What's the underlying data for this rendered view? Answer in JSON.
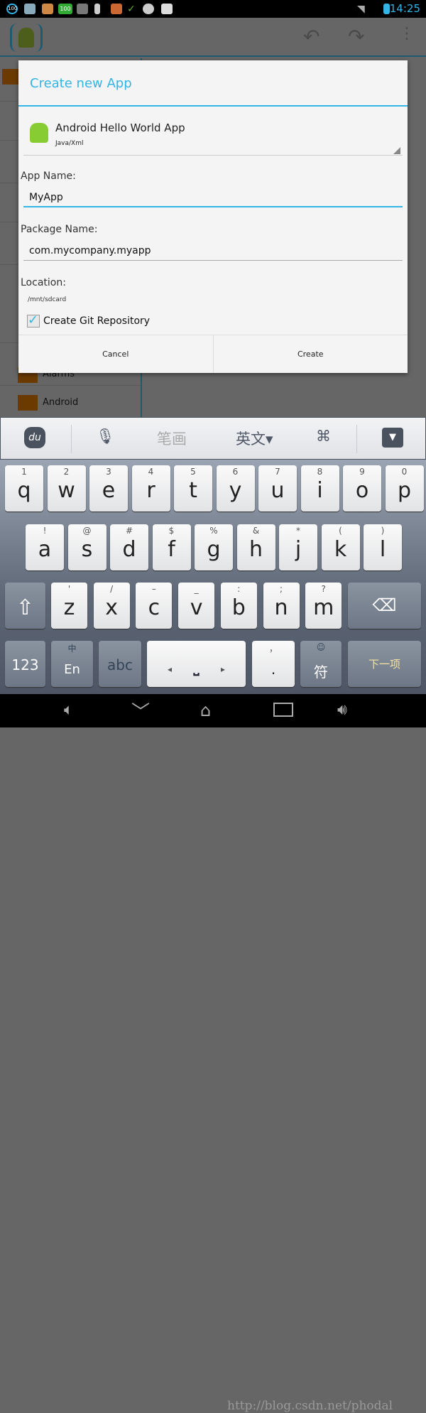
{
  "status": {
    "time": "14:25",
    "battery_label": "100",
    "notif_badge": "100"
  },
  "actionbar": {
    "icons": [
      "app-logo-icon",
      "undo-icon",
      "redo-icon",
      "overflow-icon"
    ]
  },
  "background_list": [
    "Alarms",
    "Android"
  ],
  "dialog": {
    "title": "Create new App",
    "template": {
      "name": "Android Hello World App",
      "subtitle": "Java/Xml"
    },
    "app_name_label": "App Name:",
    "app_name_value": "MyApp",
    "package_label": "Package Name:",
    "package_value": "com.mycompany.myapp",
    "location_label": "Location:",
    "location_value": "/mnt/sdcard",
    "git_label": "Create Git Repository",
    "git_checked": true,
    "cancel": "Cancel",
    "create": "Create"
  },
  "ime_bar": {
    "logo": "du",
    "stroke": "笔画",
    "lang": "英文▾"
  },
  "keyboard": {
    "row1": [
      [
        "1",
        "q"
      ],
      [
        "2",
        "w"
      ],
      [
        "3",
        "e"
      ],
      [
        "4",
        "r"
      ],
      [
        "5",
        "t"
      ],
      [
        "6",
        "y"
      ],
      [
        "7",
        "u"
      ],
      [
        "8",
        "i"
      ],
      [
        "9",
        "o"
      ],
      [
        "0",
        "p"
      ]
    ],
    "row2": [
      [
        "!",
        "a"
      ],
      [
        "@",
        "s"
      ],
      [
        "#",
        "d"
      ],
      [
        "$",
        "f"
      ],
      [
        "%",
        "g"
      ],
      [
        "&",
        "h"
      ],
      [
        "*",
        "j"
      ],
      [
        "(",
        "k"
      ],
      [
        ")",
        "l"
      ]
    ],
    "row3": [
      [
        "'",
        "z"
      ],
      [
        "/",
        "x"
      ],
      [
        "–",
        "c"
      ],
      [
        "_",
        "v"
      ],
      [
        ":",
        "b"
      ],
      [
        ";",
        "n"
      ],
      [
        "?",
        "m"
      ]
    ],
    "num": "123",
    "lang_top": "中",
    "lang": "En",
    "abc": "abc",
    "punct_top": "，",
    "punct": ".",
    "sym_top": "☺",
    "sym": "符",
    "next": "下一项"
  },
  "watermark": "http://blog.csdn.net/phodal"
}
